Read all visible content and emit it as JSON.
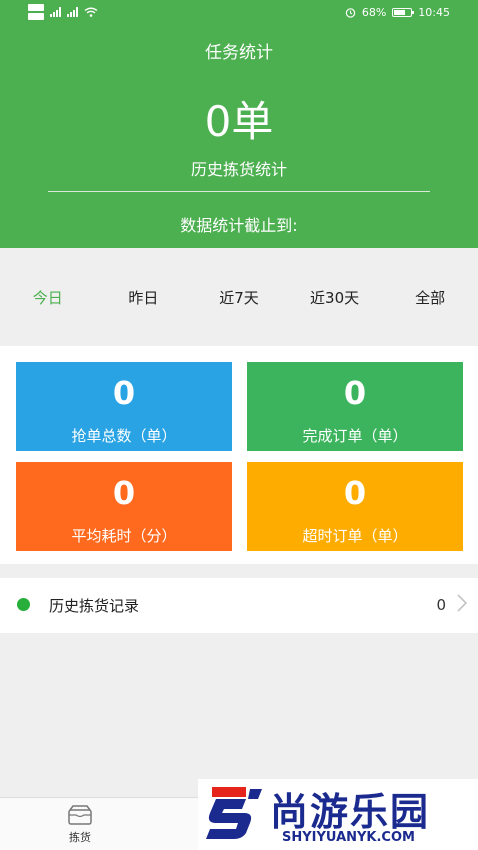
{
  "status_bar": {
    "left_labels": [
      "HD",
      "HD",
      "4G",
      "4G"
    ],
    "battery_pct": "68%",
    "battery_level": 0.68,
    "time": "10:45"
  },
  "header": {
    "title": "任务统计",
    "count": "0单",
    "subtitle": "历史拣货统计",
    "cutoff": "数据统计截止到:"
  },
  "tabs": [
    {
      "label": "今日",
      "active": true
    },
    {
      "label": "昨日",
      "active": false
    },
    {
      "label": "近7天",
      "active": false
    },
    {
      "label": "近30天",
      "active": false
    },
    {
      "label": "全部",
      "active": false
    }
  ],
  "cards": [
    {
      "value": "0",
      "label": "抢单总数（单）",
      "color": "#29a3e4"
    },
    {
      "value": "0",
      "label": "完成订单（单）",
      "color": "#3bb45d"
    },
    {
      "value": "0",
      "label": "平均耗时（分）",
      "color": "#ff6a1f"
    },
    {
      "value": "0",
      "label": "超时订单（单）",
      "color": "#ffac00"
    }
  ],
  "record": {
    "label": "历史拣货记录",
    "count": "0"
  },
  "bottom_nav": {
    "items": [
      {
        "label": "拣货",
        "icon": "inbox-icon"
      }
    ]
  },
  "watermark": {
    "text": "尚游乐园",
    "url": "SHYIYUANYK.COM"
  },
  "colors": {
    "header_green": "#4caf50",
    "active_tab": "#4caf50",
    "brand_blue": "#1b2a8f",
    "brand_red": "#e5241c"
  }
}
